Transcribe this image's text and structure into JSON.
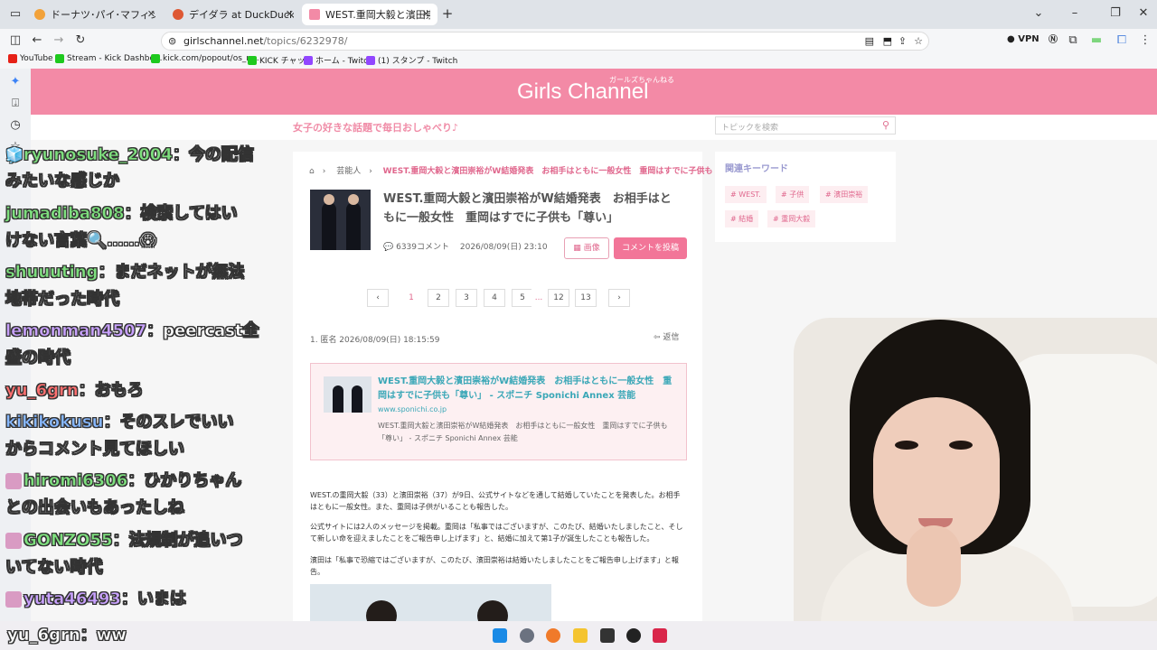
{
  "browser": {
    "tabs": [
      {
        "label": "ドーナツ･パイ･マフィン｜メニュー｜ミ",
        "active": false
      },
      {
        "label": "デイダラ at DuckDuckGo",
        "active": false
      },
      {
        "label": "WEST.重岡大毅と濱田崇裕がW結",
        "active": true
      }
    ],
    "new_tab": "+",
    "url_host": "girlschannel.net",
    "url_path": "/topics/6232978/",
    "vpn_label": "VPN",
    "bookmarks": [
      "YouTube",
      "Stream - Kick Dashbo...",
      "kick.com/popout/os_n...",
      "KICK チャット",
      "ホーム - Twitch",
      "(1) スタンプ - Twitch"
    ]
  },
  "site": {
    "logo": "Girls Channel",
    "logo_sub": "ガールズちゃんねる",
    "tagline": "女子の好きな話題で毎日おしゃべり♪",
    "search_placeholder": "トピックを検索"
  },
  "topic": {
    "breadcrumb": [
      "芸能人",
      "WEST.重岡大毅と濱田崇裕がW結婚発表　お相手はともに一般女性　重岡はすでに子供も「…"
    ],
    "title": "WEST.重岡大毅と濱田崇裕がW結婚発表　お相手はともに一般女性　重岡はすでに子供も「尊い」",
    "comments": "6339コメント",
    "datetime": "2026/08/09(日) 23:10",
    "image_button": "画像",
    "post_button": "コメントを投稿",
    "pages": [
      "‹",
      "1",
      "2",
      "3",
      "4",
      "5",
      "...",
      "12",
      "13",
      "›"
    ],
    "comment1_header": "1. 匿名 2026/08/09(日) 18:15:59",
    "reply_label": "返信",
    "card": {
      "title": "WEST.重岡大毅と濱田崇裕がW結婚発表　お相手はともに一般女性　重岡はすでに子供も「尊い」 - スポニチ Sponichi Annex 芸能",
      "host": "www.sponichi.co.jp",
      "desc": "WEST.重岡大毅と濱田崇裕がW結婚発表　お相手はともに一般女性　重岡はすでに子供も「尊い」 - スポニチ Sponichi Annex 芸能"
    },
    "paragraphs": [
      "WEST.の重岡大毅（33）と濱田崇裕（37）が9日、公式サイトなどを通して結婚していたことを発表した。お相手はともに一般女性。また、重岡は子供がいることも報告した。",
      "公式サイトには2人のメッセージを掲載。重岡は「私事ではございますが、このたび、結婚いたしましたこと、そして新しい命を迎えましたことをご報告申し上げます」と、結婚に加えて第1子が誕生したことも報告した。",
      "濱田は「私事で恐縮ではございますが、このたび、濱田崇裕は結婚いたしましたことをご報告申し上げます」と報告。"
    ]
  },
  "sidebar": {
    "title": "関連キーワード",
    "keywords": [
      "# WEST.",
      "# 子供",
      "# 濱田崇裕",
      "# 結婚",
      "# 重岡大毅"
    ]
  },
  "chat": [
    {
      "name": "ryunosuke_2004",
      "msg1": "：今の配信",
      "msg2": "みたいな感じか",
      "color": "cn"
    },
    {
      "name": "jumadiba808",
      "msg1": "：検索してはい",
      "msg2": "けない言葉🔍……😱",
      "color": "cn"
    },
    {
      "name": "shuuuting",
      "msg1": "：まだネットが無法",
      "msg2": "地帯だった時代",
      "color": "cn"
    },
    {
      "name": "lemonman4507",
      "msg1": "：peercast全",
      "msg2": "盛の時代",
      "color": "cn pu"
    },
    {
      "name": "yu_6grn",
      "msg1": "：おもろ",
      "msg2": "",
      "color": "cn re"
    },
    {
      "name": "kikikokusu",
      "msg1": "：そのスレでいい",
      "msg2": "からコメント見てほしい",
      "color": "cn bl"
    },
    {
      "name": "hiromi6306",
      "msg1": "：ひかりちゃん",
      "msg2": "との出会いもあったしね",
      "color": "cn"
    },
    {
      "name": "GONZO55",
      "msg1": "：法規制が追いつ",
      "msg2": "いてない時代",
      "color": "cn"
    },
    {
      "name": "yuta46493",
      "msg1": "：いまは",
      "msg2": "",
      "color": "cn pu"
    }
  ],
  "bottom_chat": {
    "name": "yu_6grn",
    "msg": "：ww"
  },
  "colors": {
    "brand": "#f38aa6",
    "accent": "#f27598",
    "link": "#3aa7b7"
  }
}
